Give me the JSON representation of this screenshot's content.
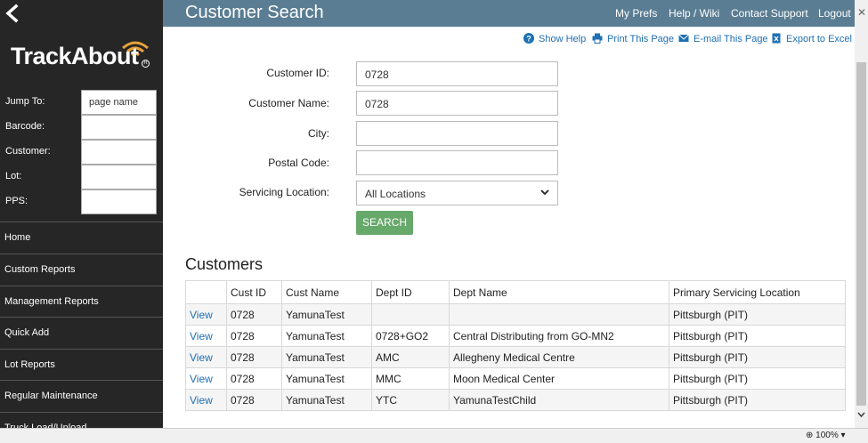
{
  "sidebar": {
    "logo": "TrackAbout",
    "jump": [
      {
        "label": "Jump To:",
        "value": "page name"
      },
      {
        "label": "Barcode:",
        "value": ""
      },
      {
        "label": "Customer:",
        "value": ""
      },
      {
        "label": "Lot:",
        "value": ""
      },
      {
        "label": "PPS:",
        "value": ""
      }
    ],
    "nav": [
      "Home",
      "Custom Reports",
      "Management Reports",
      "Quick Add",
      "Lot Reports",
      "Regular Maintenance",
      "Truck Load/Unload"
    ]
  },
  "header": {
    "title": "Customer Search",
    "links": [
      "My Prefs",
      "Help / Wiki",
      "Contact Support",
      "Logout"
    ]
  },
  "actions": [
    "Show Help",
    "Print This Page",
    "E-mail This Page",
    "Export to Excel"
  ],
  "form": {
    "customer_id": {
      "label": "Customer ID:",
      "value": "0728"
    },
    "customer_name": {
      "label": "Customer Name:",
      "value": "0728"
    },
    "city": {
      "label": "City:",
      "value": ""
    },
    "postal_code": {
      "label": "Postal Code:",
      "value": ""
    },
    "servicing_location": {
      "label": "Servicing Location:",
      "value": "All Locations"
    },
    "search_label": "SEARCH"
  },
  "customers": {
    "title": "Customers",
    "columns": [
      "",
      "Cust ID",
      "Cust Name",
      "Dept ID",
      "Dept Name",
      "Primary Servicing Location"
    ],
    "rows": [
      {
        "action": "View",
        "cust_id": "0728",
        "cust_name": "YamunaTest",
        "dept_id": "",
        "dept_name": "",
        "location": "Pittsburgh (PIT)"
      },
      {
        "action": "View",
        "cust_id": "0728",
        "cust_name": "YamunaTest",
        "dept_id": "0728+GO2",
        "dept_name": "Central Distributing from GO-MN2",
        "location": "Pittsburgh (PIT)"
      },
      {
        "action": "View",
        "cust_id": "0728",
        "cust_name": "YamunaTest",
        "dept_id": "AMC",
        "dept_name": "Allegheny Medical Centre",
        "location": "Pittsburgh (PIT)"
      },
      {
        "action": "View",
        "cust_id": "0728",
        "cust_name": "YamunaTest",
        "dept_id": "MMC",
        "dept_name": "Moon Medical Center",
        "location": "Pittsburgh (PIT)"
      },
      {
        "action": "View",
        "cust_id": "0728",
        "cust_name": "YamunaTest",
        "dept_id": "YTC",
        "dept_name": "YamunaTestChild",
        "location": "Pittsburgh (PIT)"
      }
    ]
  },
  "status": {
    "zoom": "100%"
  },
  "colors": {
    "header_bg": "#5a7d93",
    "sidebar_bg": "#262626",
    "link": "#1f6fb2",
    "search_button": "#67a96b"
  }
}
